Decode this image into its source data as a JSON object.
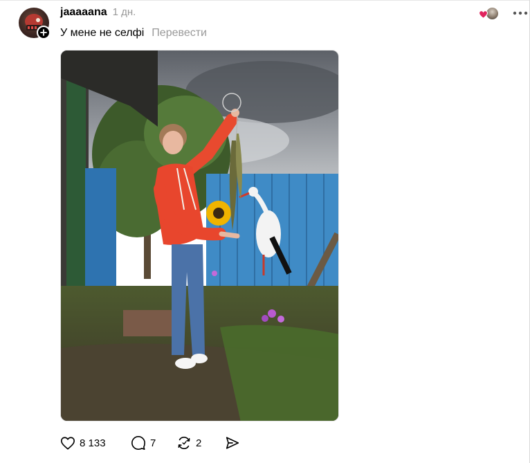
{
  "post": {
    "author": {
      "username": "jaaaaana",
      "avatar_icon": "avatar-image",
      "follow_icon": "plus-icon"
    },
    "timestamp": "1 дн.",
    "caption": "У мене не селфі",
    "translate_label": "Перевести",
    "reactions_preview": {
      "heart_color": "#e0245e",
      "icon": "heart-icon"
    },
    "more_icon": "more-icon",
    "media": {
      "type": "photo"
    },
    "actions": {
      "like_count": "8 133",
      "comment_count": "7",
      "repost_count": "2",
      "like_icon": "heart-icon",
      "comment_icon": "comment-icon",
      "repost_icon": "repost-icon",
      "share_icon": "send-icon"
    }
  },
  "colors": {
    "text_primary": "#000000",
    "text_secondary": "#999999",
    "background": "#ffffff"
  }
}
